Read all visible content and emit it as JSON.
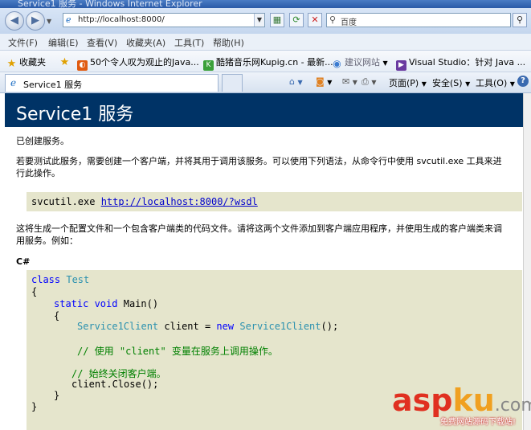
{
  "window": {
    "title": "Service1 服务 - Windows Internet Explorer"
  },
  "address": {
    "url": "http://localhost:8000/"
  },
  "search": {
    "placeholder": "百度"
  },
  "menu": [
    "文件(F)",
    "编辑(E)",
    "查看(V)",
    "收藏夹(A)",
    "工具(T)",
    "帮助(H)"
  ],
  "favorites": {
    "label": "收藏夹",
    "items": [
      "50个令人叹为观止的Java...",
      "酷猪音乐网Kupig.cn - 最新...",
      "建议网站",
      "Visual Studio：针对 Java ..."
    ]
  },
  "tab": {
    "title": "Service1 服务"
  },
  "toolbar": {
    "page": "页面(P)",
    "safety": "安全(S)",
    "tools": "工具(O)"
  },
  "page": {
    "heading": "Service1 服务",
    "created": "已创建服务。",
    "instruction": "若要测试此服务，需要创建一个客户端，并将其用于调用该服务。可以使用下列语法，从命令行中使用 svcutil.exe 工具来进行此操作。",
    "cmd_prefix": "svcutil.exe ",
    "cmd_link": "http://localhost:8000/?wsdl",
    "generate": "这将生成一个配置文件和一个包含客户端类的代码文件。请将这两个文件添加到客户端应用程序，并使用生成的客户端类来调用服务。例如：",
    "lang": "C#",
    "code": {
      "kw_class": "class",
      "class_name": "Test",
      "open1": "{",
      "kw_static_void": "static void",
      "main_sig": "Main()",
      "open2": "{",
      "client_type": "Service1Client",
      "client_decl": "client =",
      "kw_new": "new",
      "client_type2": "Service1Client",
      "ctor_end": "();",
      "comment1": "// 使用 \"client\" 变量在服务上调用操作。",
      "comment2": "// 始终关闭客户端。",
      "close_call": "client.Close();",
      "close2": "}",
      "close1": "}"
    }
  },
  "watermark": {
    "brand_a": "asp",
    "brand_k": "ku",
    "brand_c": ".com",
    "sub": "免费网站源码下载站!"
  },
  "colors": {
    "banner": "#003366",
    "code_bg": "#e5e5cc",
    "keyword": "#0000ff",
    "type": "#2b91af",
    "comment": "#008000"
  }
}
